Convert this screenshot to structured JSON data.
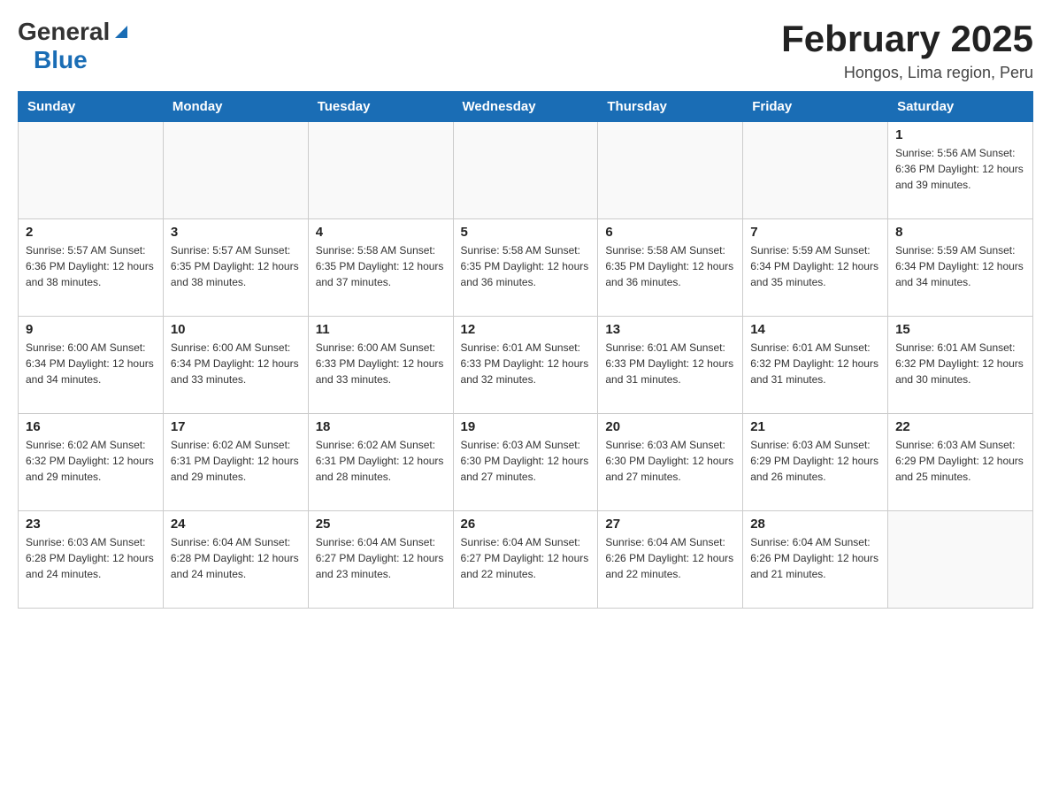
{
  "header": {
    "logo_general": "General",
    "logo_blue": "Blue",
    "month_title": "February 2025",
    "subtitle": "Hongos, Lima region, Peru"
  },
  "weekdays": [
    "Sunday",
    "Monday",
    "Tuesday",
    "Wednesday",
    "Thursday",
    "Friday",
    "Saturday"
  ],
  "weeks": [
    [
      {
        "day": "",
        "info": ""
      },
      {
        "day": "",
        "info": ""
      },
      {
        "day": "",
        "info": ""
      },
      {
        "day": "",
        "info": ""
      },
      {
        "day": "",
        "info": ""
      },
      {
        "day": "",
        "info": ""
      },
      {
        "day": "1",
        "info": "Sunrise: 5:56 AM\nSunset: 6:36 PM\nDaylight: 12 hours and 39 minutes."
      }
    ],
    [
      {
        "day": "2",
        "info": "Sunrise: 5:57 AM\nSunset: 6:36 PM\nDaylight: 12 hours and 38 minutes."
      },
      {
        "day": "3",
        "info": "Sunrise: 5:57 AM\nSunset: 6:35 PM\nDaylight: 12 hours and 38 minutes."
      },
      {
        "day": "4",
        "info": "Sunrise: 5:58 AM\nSunset: 6:35 PM\nDaylight: 12 hours and 37 minutes."
      },
      {
        "day": "5",
        "info": "Sunrise: 5:58 AM\nSunset: 6:35 PM\nDaylight: 12 hours and 36 minutes."
      },
      {
        "day": "6",
        "info": "Sunrise: 5:58 AM\nSunset: 6:35 PM\nDaylight: 12 hours and 36 minutes."
      },
      {
        "day": "7",
        "info": "Sunrise: 5:59 AM\nSunset: 6:34 PM\nDaylight: 12 hours and 35 minutes."
      },
      {
        "day": "8",
        "info": "Sunrise: 5:59 AM\nSunset: 6:34 PM\nDaylight: 12 hours and 34 minutes."
      }
    ],
    [
      {
        "day": "9",
        "info": "Sunrise: 6:00 AM\nSunset: 6:34 PM\nDaylight: 12 hours and 34 minutes."
      },
      {
        "day": "10",
        "info": "Sunrise: 6:00 AM\nSunset: 6:34 PM\nDaylight: 12 hours and 33 minutes."
      },
      {
        "day": "11",
        "info": "Sunrise: 6:00 AM\nSunset: 6:33 PM\nDaylight: 12 hours and 33 minutes."
      },
      {
        "day": "12",
        "info": "Sunrise: 6:01 AM\nSunset: 6:33 PM\nDaylight: 12 hours and 32 minutes."
      },
      {
        "day": "13",
        "info": "Sunrise: 6:01 AM\nSunset: 6:33 PM\nDaylight: 12 hours and 31 minutes."
      },
      {
        "day": "14",
        "info": "Sunrise: 6:01 AM\nSunset: 6:32 PM\nDaylight: 12 hours and 31 minutes."
      },
      {
        "day": "15",
        "info": "Sunrise: 6:01 AM\nSunset: 6:32 PM\nDaylight: 12 hours and 30 minutes."
      }
    ],
    [
      {
        "day": "16",
        "info": "Sunrise: 6:02 AM\nSunset: 6:32 PM\nDaylight: 12 hours and 29 minutes."
      },
      {
        "day": "17",
        "info": "Sunrise: 6:02 AM\nSunset: 6:31 PM\nDaylight: 12 hours and 29 minutes."
      },
      {
        "day": "18",
        "info": "Sunrise: 6:02 AM\nSunset: 6:31 PM\nDaylight: 12 hours and 28 minutes."
      },
      {
        "day": "19",
        "info": "Sunrise: 6:03 AM\nSunset: 6:30 PM\nDaylight: 12 hours and 27 minutes."
      },
      {
        "day": "20",
        "info": "Sunrise: 6:03 AM\nSunset: 6:30 PM\nDaylight: 12 hours and 27 minutes."
      },
      {
        "day": "21",
        "info": "Sunrise: 6:03 AM\nSunset: 6:29 PM\nDaylight: 12 hours and 26 minutes."
      },
      {
        "day": "22",
        "info": "Sunrise: 6:03 AM\nSunset: 6:29 PM\nDaylight: 12 hours and 25 minutes."
      }
    ],
    [
      {
        "day": "23",
        "info": "Sunrise: 6:03 AM\nSunset: 6:28 PM\nDaylight: 12 hours and 24 minutes."
      },
      {
        "day": "24",
        "info": "Sunrise: 6:04 AM\nSunset: 6:28 PM\nDaylight: 12 hours and 24 minutes."
      },
      {
        "day": "25",
        "info": "Sunrise: 6:04 AM\nSunset: 6:27 PM\nDaylight: 12 hours and 23 minutes."
      },
      {
        "day": "26",
        "info": "Sunrise: 6:04 AM\nSunset: 6:27 PM\nDaylight: 12 hours and 22 minutes."
      },
      {
        "day": "27",
        "info": "Sunrise: 6:04 AM\nSunset: 6:26 PM\nDaylight: 12 hours and 22 minutes."
      },
      {
        "day": "28",
        "info": "Sunrise: 6:04 AM\nSunset: 6:26 PM\nDaylight: 12 hours and 21 minutes."
      },
      {
        "day": "",
        "info": ""
      }
    ]
  ]
}
